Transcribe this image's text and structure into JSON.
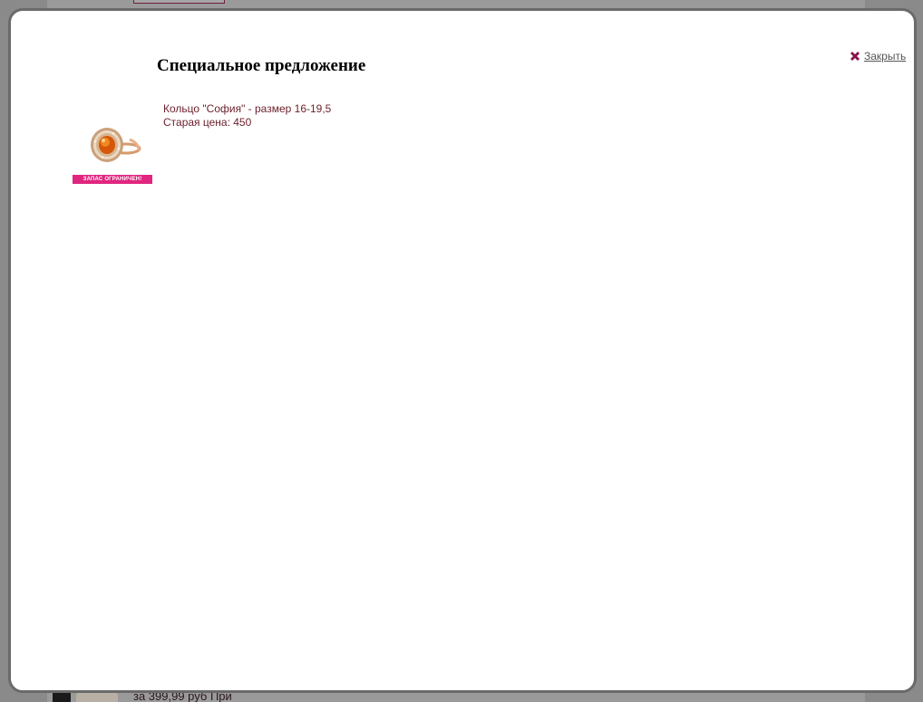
{
  "background_page": {
    "bottom_text": "за 399,99 руб При"
  },
  "modal": {
    "title": "Специальное предложение",
    "close_label": " Закрыть",
    "product": {
      "name": "Кольцо \"София\" - размер 16-19,5",
      "old_price": "Старая цена: 450",
      "badge": "ЗАПАС ОГРАНИЧЕН!"
    }
  },
  "colors": {
    "accent": "#e0267f",
    "text_maroon": "#6b1f2a",
    "close_icon": "#8b1048"
  },
  "icons": {
    "close": "close-icon"
  }
}
